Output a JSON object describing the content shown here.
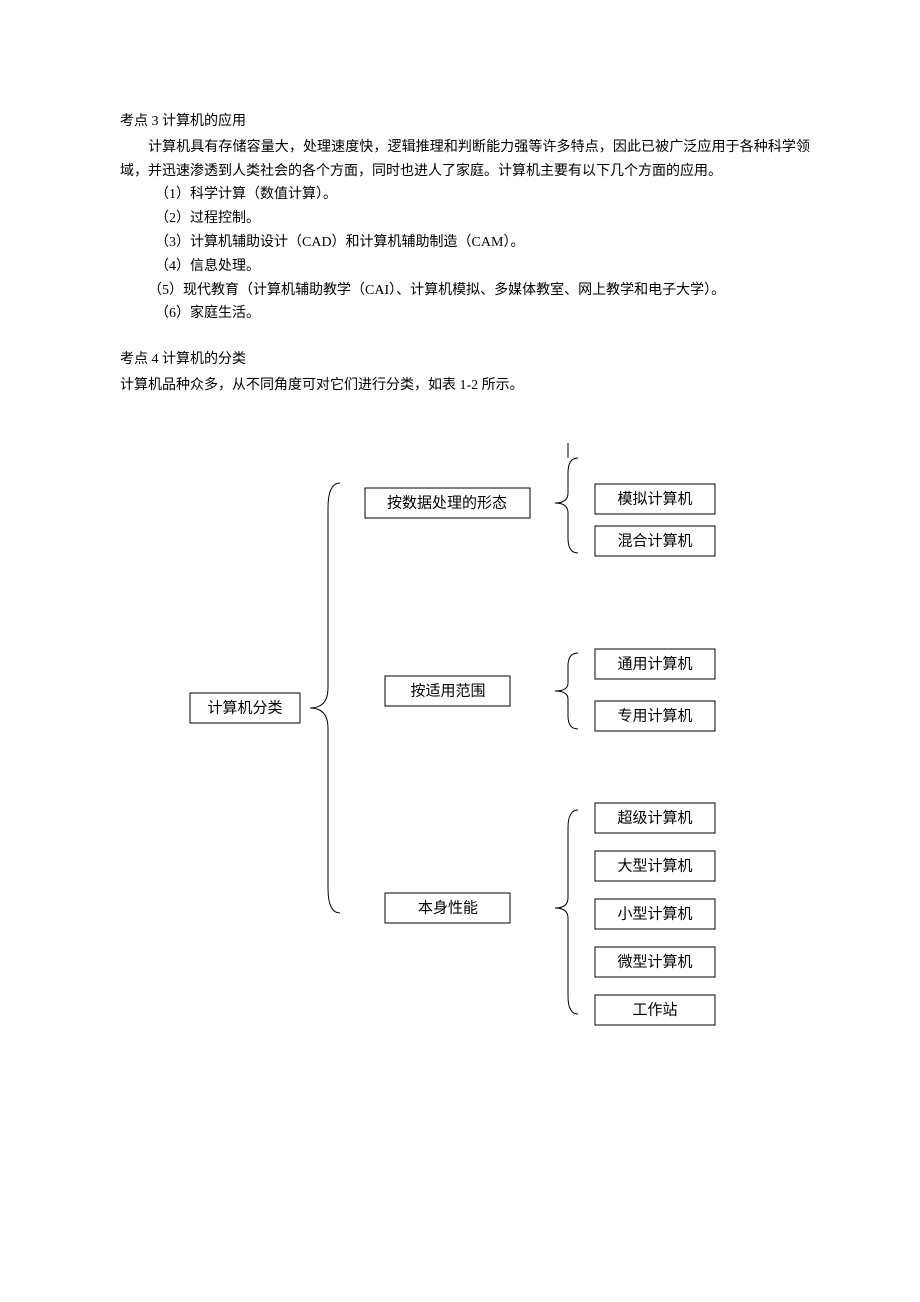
{
  "section3": {
    "heading": "考点 3   计算机的应用",
    "intro": "计算机具有存储容量大，处理速度快，逻辑推理和判断能力强等许多特点，因此已被广泛应用于各种科学领域，并迅速渗透到人类社会的各个方面，同时也进人了家庭。计算机主要有以下几个方面的应用。",
    "items": {
      "i1": "（1）科学计算（数值计算）。",
      "i2": "（2）过程控制。",
      "i3": "（3）计算机辅助设计（CAD）和计算机辅助制造（CAM）。",
      "i4": "（4）信息处理。",
      "i5": "（5）现代教育（计算机辅助教学（CAI）、计算机模拟、多媒体教室、网上教学和电子大学）。",
      "i6": "（6）家庭生活。"
    }
  },
  "section4": {
    "heading": "考点 4 计算机的分类",
    "intro": "计算机品种众多，从不同角度可对它们进行分类，如表 1-2 所示。"
  },
  "chart_data": {
    "type": "tree",
    "root": "计算机分类",
    "branches": [
      {
        "label": "按数据处理的形态",
        "children": [
          "模拟计算机",
          "混合计算机"
        ]
      },
      {
        "label": "按适用范围",
        "children": [
          "通用计算机",
          "专用计算机"
        ]
      },
      {
        "label": "本身性能",
        "children": [
          "超级计算机",
          "大型计算机",
          "小型计算机",
          "微型计算机",
          "工作站"
        ]
      }
    ]
  }
}
